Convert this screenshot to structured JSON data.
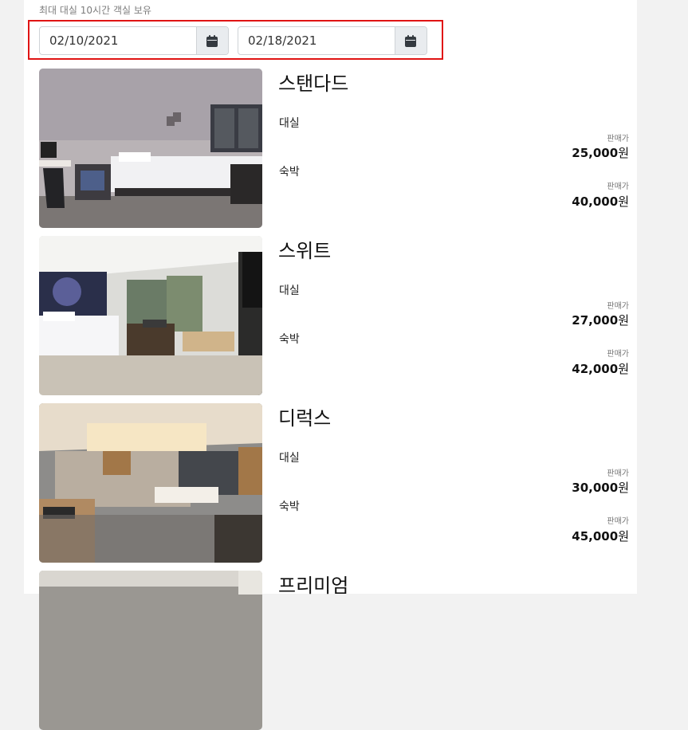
{
  "notice": "최대 대실 10시간 객실 보유",
  "dates": {
    "checkin": "02/10/2021",
    "checkout": "02/18/2021"
  },
  "rooms": [
    {
      "name": "스탠다드",
      "rates": [
        {
          "label": "대실",
          "caption": "판매가",
          "amount": "25,000",
          "unit": "원"
        },
        {
          "label": "숙박",
          "caption": "판매가",
          "amount": "40,000",
          "unit": "원"
        }
      ]
    },
    {
      "name": "스위트",
      "rates": [
        {
          "label": "대실",
          "caption": "판매가",
          "amount": "27,000",
          "unit": "원"
        },
        {
          "label": "숙박",
          "caption": "판매가",
          "amount": "42,000",
          "unit": "원"
        }
      ]
    },
    {
      "name": "디럭스",
      "rates": [
        {
          "label": "대실",
          "caption": "판매가",
          "amount": "30,000",
          "unit": "원"
        },
        {
          "label": "숙박",
          "caption": "판매가",
          "amount": "45,000",
          "unit": "원"
        }
      ]
    },
    {
      "name": "프리미엄"
    }
  ]
}
